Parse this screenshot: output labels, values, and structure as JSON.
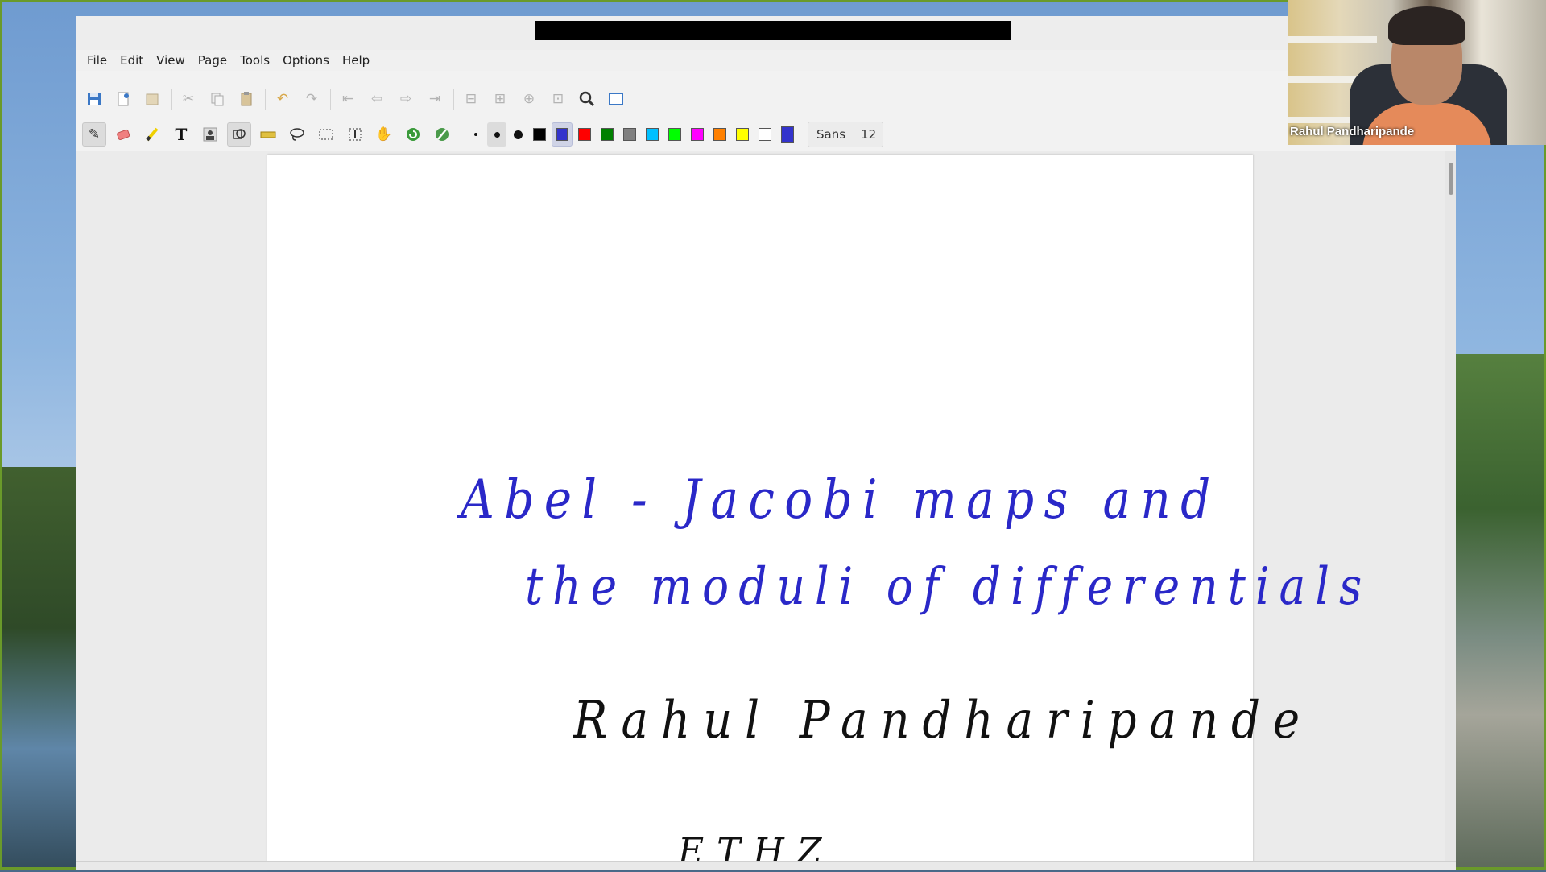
{
  "menu": [
    "File",
    "Edit",
    "View",
    "Page",
    "Tools",
    "Options",
    "Help"
  ],
  "toolbar1_icons": [
    "save-icon",
    "new-page-icon",
    "open-icon",
    "cut-icon",
    "copy-icon",
    "paste-icon",
    "undo-icon",
    "redo-icon",
    "first-page-icon",
    "prev-page-icon",
    "next-page-icon",
    "last-page-icon",
    "zoom-out-icon",
    "zoom-fit-icon",
    "zoom-in-icon",
    "zoom-page-icon",
    "search-icon",
    "fullscreen-icon"
  ],
  "toolbar2_tools": [
    "pen-icon",
    "eraser-icon",
    "highlighter-icon",
    "text-icon",
    "image-icon",
    "shape-recognizer-icon",
    "ruler-icon",
    "lasso-icon",
    "rect-select-icon",
    "vertical-space-icon",
    "hand-icon",
    "default-tools-icon",
    "pen-settings-icon"
  ],
  "pen_sizes": [
    "fine",
    "medium",
    "thick"
  ],
  "colors": [
    "#000000",
    "#3333cc",
    "#ff0000",
    "#008000",
    "#808080",
    "#00c0ff",
    "#00ff00",
    "#ff00ff",
    "#ff8000",
    "#ffff00",
    "#ffffff"
  ],
  "selected_color": "#3333cc",
  "current_color": "#3333cc",
  "font": {
    "name": "Sans",
    "size": "12"
  },
  "handwriting": {
    "line1": "Abel - Jacobi maps and",
    "line2": "the moduli of differentials",
    "author": "Rahul Pandharipande",
    "affiliation": "ETHZ"
  },
  "webcam": {
    "name": "Rahul Pandharipande"
  }
}
